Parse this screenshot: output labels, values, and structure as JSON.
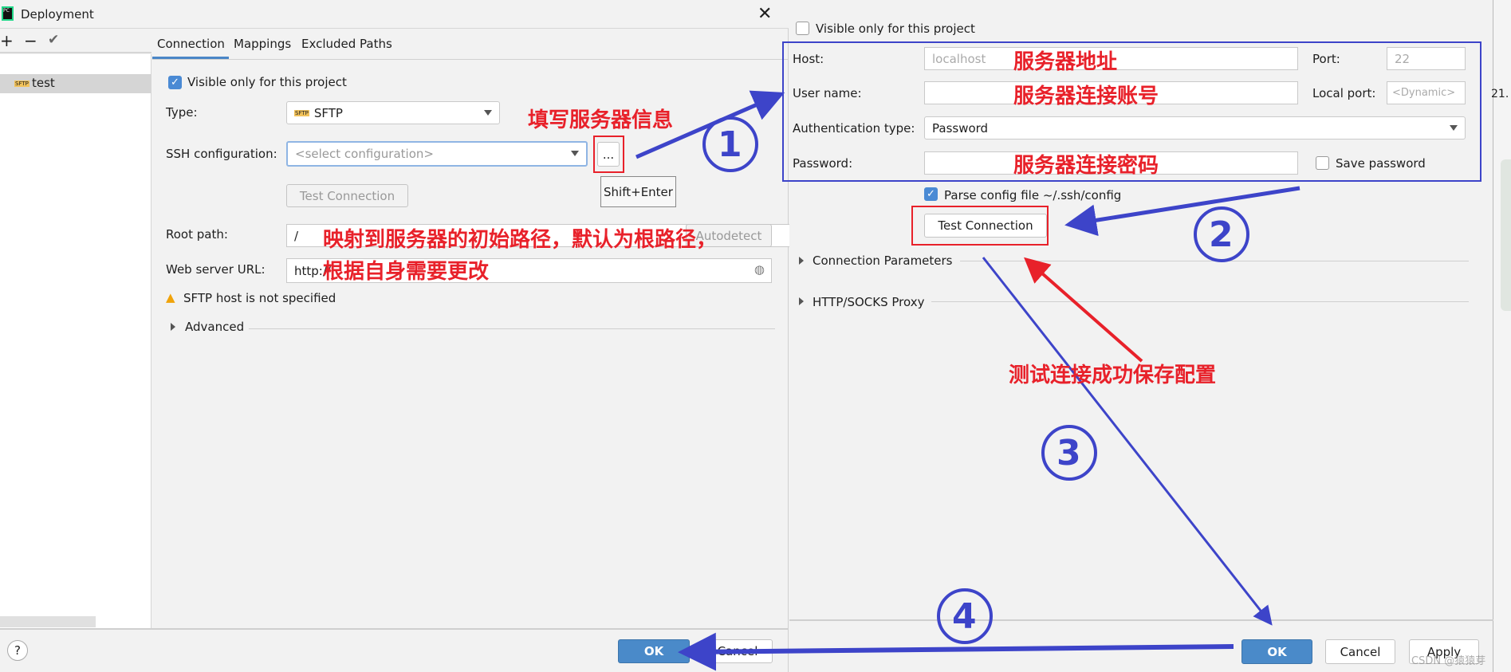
{
  "left_dialog": {
    "title": "Deployment",
    "toolbar": {
      "add": "+",
      "remove": "−",
      "apply": "✔"
    },
    "servers": [
      {
        "name": "test",
        "type_badge": "SFTP"
      }
    ],
    "tabs": [
      {
        "label": "Connection",
        "active": true
      },
      {
        "label": "Mappings"
      },
      {
        "label": "Excluded Paths"
      }
    ],
    "visible_only_label": "Visible only for this project",
    "visible_only_checked": true,
    "type_label": "Type:",
    "type_value": "SFTP",
    "ssh_label": "SSH configuration:",
    "ssh_placeholder": "<select configuration>",
    "browse_label": "...",
    "tooltip": "Shift+Enter",
    "test_connection": "Test Connection",
    "root_label": "Root path:",
    "root_value": "/",
    "autodetect": "Autodetect",
    "web_label": "Web server URL:",
    "web_value": "http://",
    "warning": "SFTP host is not specified",
    "advanced": "Advanced",
    "help": "?",
    "ok": "OK",
    "cancel": "Cancel"
  },
  "right_dialog": {
    "visible_only_label": "Visible only for this project",
    "visible_only_checked": false,
    "host_label": "Host:",
    "host_placeholder": "localhost",
    "port_label": "Port:",
    "port_placeholder": "22",
    "user_label": "User name:",
    "local_port_label": "Local port:",
    "local_port_placeholder": "<Dynamic>",
    "auth_label": "Authentication type:",
    "auth_value": "Password",
    "password_label": "Password:",
    "save_password": "Save password",
    "save_password_checked": false,
    "parse_config": "Parse config file ~/.ssh/config",
    "parse_config_checked": true,
    "test_connection": "Test Connection",
    "connection_parameters": "Connection Parameters",
    "proxy": "HTTP/SOCKS Proxy",
    "ok": "OK",
    "cancel": "Cancel",
    "apply": "Apply"
  },
  "background_strip": {
    "text": "21."
  },
  "annotations": {
    "fill_info": "填写服务器信息",
    "root_note_line1": "映射到服务器的初始路径，默认为根路径，",
    "root_note_line2": "根据自身需要更改",
    "host_note": "服务器地址",
    "user_note": "服务器连接账号",
    "password_note": "服务器连接密码",
    "test_note": "测试连接成功保存配置",
    "step1": "①",
    "step2": "②",
    "step3": "③",
    "step4": "④",
    "arrow_blue": "#3d44c9",
    "arrow_red": "#e8212a"
  },
  "watermark": "CSDN @猿猿芽"
}
